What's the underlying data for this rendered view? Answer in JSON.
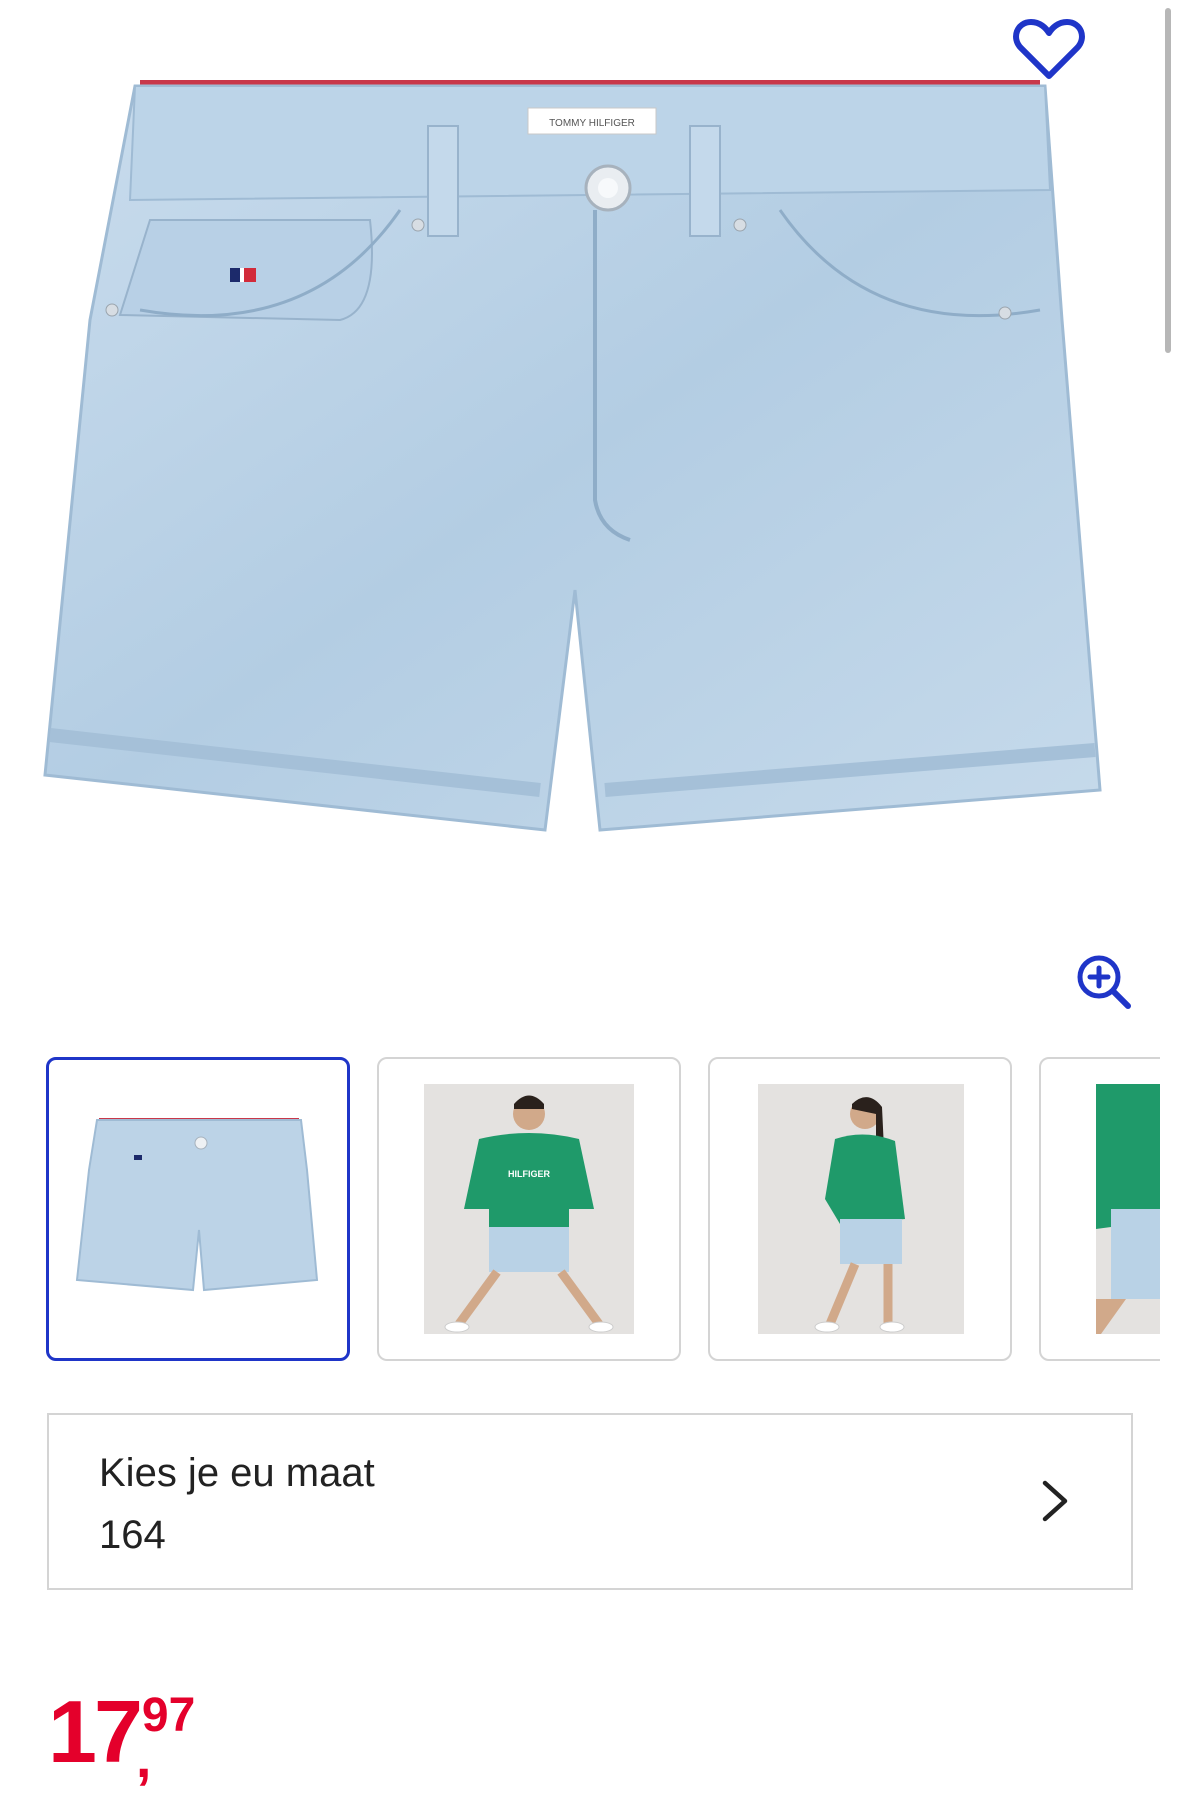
{
  "product": {
    "image_alt": "Tommy Hilfiger light blue denim shorts",
    "brand_label": "TOMMY HILFIGER"
  },
  "actions": {
    "favorite_icon": "heart-outline-icon",
    "zoom_icon": "zoom-in-icon"
  },
  "thumbnails": [
    {
      "name": "thumbnail-shorts-front",
      "selected": true
    },
    {
      "name": "thumbnail-model-front",
      "selected": false
    },
    {
      "name": "thumbnail-model-side",
      "selected": false
    },
    {
      "name": "thumbnail-model-closeup",
      "selected": false
    }
  ],
  "size_selector": {
    "label": "Kies je eu maat",
    "value": "164",
    "icon": "chevron-right-icon"
  },
  "price": {
    "euros": "17",
    "cents": "97",
    "separator": ","
  },
  "colors": {
    "accent": "#1f35c8",
    "price": "#e4002b",
    "denim": "#b9d2e6",
    "sweater": "#1f9a6a"
  }
}
